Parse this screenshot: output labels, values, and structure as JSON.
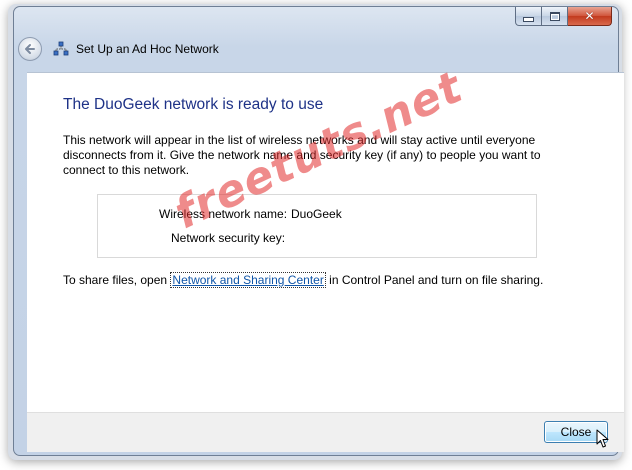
{
  "window": {
    "title": "Set Up an Ad Hoc Network",
    "minimize_icon": "minimize-icon",
    "maximize_icon": "maximize-icon",
    "close_icon": "close-icon"
  },
  "content": {
    "heading": "The DuoGeek network is ready to use",
    "description": "This network will appear in the list of wireless networks and will stay active until everyone disconnects from it. Give the network name and security key (if any) to people you want to connect to this network.",
    "network_name_label": "Wireless network name:",
    "network_name_value": "DuoGeek",
    "security_key_label": "Network security key:",
    "security_key_value": "",
    "share_prefix": "To share files, open ",
    "share_link": "Network and Sharing Center",
    "share_suffix": " in Control Panel and turn on file sharing."
  },
  "watermark": "freetuts.net",
  "footer": {
    "close_label": "Close"
  },
  "colors": {
    "heading": "#1e3287",
    "link": "#0f55a8",
    "watermark": "#e22b2b"
  }
}
